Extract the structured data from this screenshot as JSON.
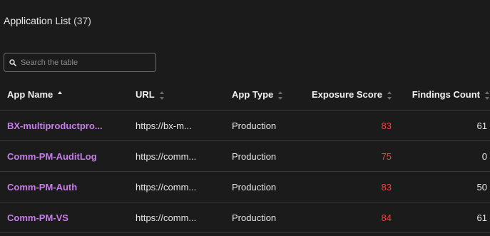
{
  "header": {
    "title": "Application List",
    "count": "(37)"
  },
  "search": {
    "placeholder": "Search the table",
    "value": ""
  },
  "table": {
    "columns": [
      {
        "label": "App Name",
        "sort": "ascending"
      },
      {
        "label": "URL",
        "sort": "none"
      },
      {
        "label": "App Type",
        "sort": "none"
      },
      {
        "label": "Exposure Score",
        "sort": "none"
      },
      {
        "label": "Findings Count",
        "sort": "none"
      }
    ],
    "rows": [
      {
        "app_name": "BX-multiproductpro...",
        "url": "https://bx-m...",
        "app_type": "Production",
        "exposure_score": "83",
        "findings_count": "61"
      },
      {
        "app_name": "Comm-PM-AuditLog",
        "url": "https://comm...",
        "app_type": "Production",
        "exposure_score": "75",
        "findings_count": "0"
      },
      {
        "app_name": "Comm-PM-Auth",
        "url": "https://comm...",
        "app_type": "Production",
        "exposure_score": "83",
        "findings_count": "50"
      },
      {
        "app_name": "Comm-PM-VS",
        "url": "https://comm...",
        "app_type": "Production",
        "exposure_score": "84",
        "findings_count": "61"
      }
    ]
  },
  "colors": {
    "background": "#1b1b1c",
    "app_link": "#c77dea",
    "high_score": "#f2433c",
    "divider": "#3a3a3c"
  }
}
